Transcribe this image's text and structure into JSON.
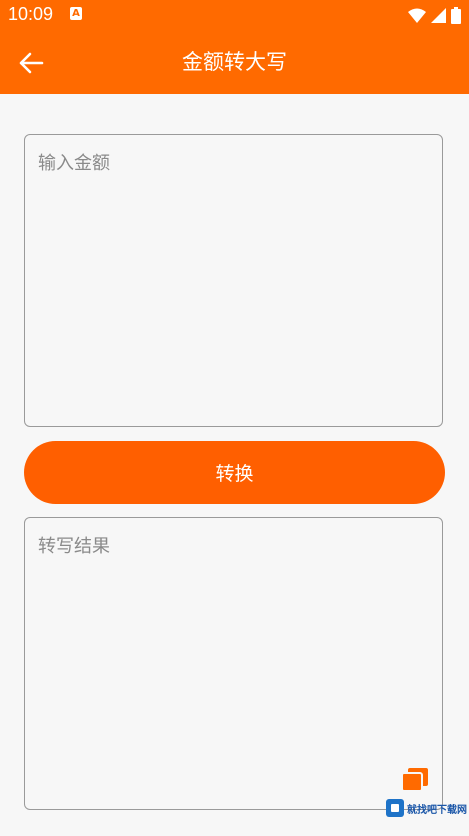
{
  "status_bar": {
    "time": "10:09",
    "notification_icon": "A"
  },
  "app_bar": {
    "title": "金额转大写",
    "back_icon": "arrow-left-icon"
  },
  "amount_input": {
    "placeholder": "输入金额",
    "value": ""
  },
  "convert_button": {
    "label": "转换"
  },
  "result_output": {
    "placeholder": "转写结果",
    "value": ""
  },
  "copy_icon": "copy-icon",
  "watermark": {
    "text": "就找吧下载网"
  },
  "colors": {
    "accent": "#ff6a00",
    "button": "#ff5f00",
    "background": "#f7f7f7",
    "border": "#9a9a9a"
  }
}
